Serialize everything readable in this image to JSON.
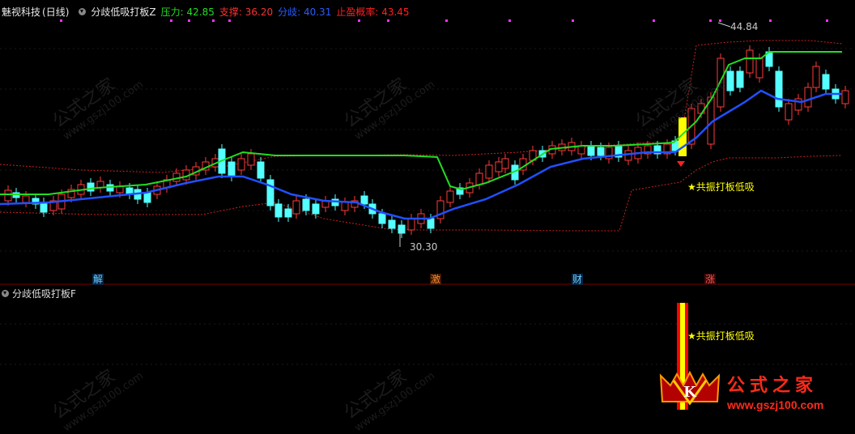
{
  "header": {
    "stock_name": "魅视科技",
    "period": "(日线)",
    "indicator_name": "分歧低吸打板Z",
    "pressure_label": "压力:",
    "pressure_value": "42.85",
    "support_label": "支撑:",
    "support_value": "36.20",
    "divergence_label": "分歧:",
    "divergence_value": "40.31",
    "takeprofit_label": "止盈概率:",
    "takeprofit_value": "43.45"
  },
  "colors": {
    "pressure": "#22dd22",
    "support": "#ff3030",
    "divergence": "#2050ff",
    "takeprofit": "#ff2020",
    "up_candle": "#ff3a3a",
    "down_candle": "#54ffff",
    "signal": "#ffff00",
    "magenta_dot": "#ff33ff"
  },
  "chart": {
    "high_label": "44.84",
    "low_label": "30.30",
    "signal_label": "★共振打板低吸",
    "event_tags": [
      {
        "text": "解",
        "color": "#66ccff",
        "bg": "#0a2440"
      },
      {
        "text": "激",
        "color": "#ff8a33",
        "bg": "#3a1800"
      },
      {
        "text": "财",
        "color": "#66ccff",
        "bg": "#0a2440"
      },
      {
        "text": "涨",
        "color": "#ff5050",
        "bg": "#3a0808"
      }
    ]
  },
  "sub_panel": {
    "title": "分歧低吸打板F",
    "signal_label": "★共振打板低吸"
  },
  "watermark": {
    "text": "公式之家",
    "url": "www.gszj100.com"
  },
  "logo": {
    "text": "公式之家",
    "url": "www.gszj100.com"
  }
}
